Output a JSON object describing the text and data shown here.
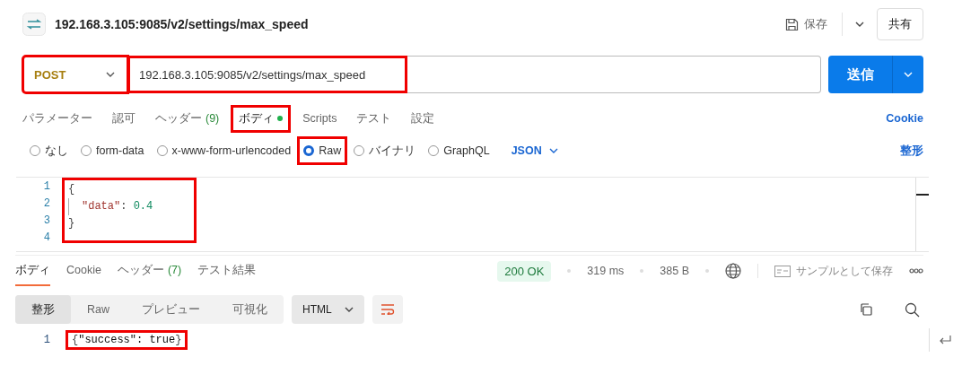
{
  "title": "192.168.3.105:9085/v2/settings/max_speed",
  "save_label": "保存",
  "share_label": "共有",
  "request": {
    "method": {
      "label": "POST",
      "highlighted": true
    },
    "url": {
      "value": "192.168.3.105:9085/v2/settings/max_speed",
      "highlighted": true
    },
    "send_label": "送信"
  },
  "request_tabs": [
    {
      "label": "パラメーター",
      "selected": false,
      "highlighted": false,
      "dot": false
    },
    {
      "label": "認可",
      "selected": false,
      "highlighted": false,
      "dot": false
    },
    {
      "label": "ヘッダー",
      "count": "(9)",
      "selected": false,
      "highlighted": false,
      "dot": false
    },
    {
      "label": "ボディ",
      "selected": true,
      "highlighted": true,
      "dot": true
    },
    {
      "label": "Scripts",
      "selected": false,
      "highlighted": false,
      "dot": false
    },
    {
      "label": "テスト",
      "selected": false,
      "highlighted": false,
      "dot": false
    },
    {
      "label": "設定",
      "selected": false,
      "highlighted": false,
      "dot": false
    }
  ],
  "cookie_link": "Cookie",
  "body_types": [
    {
      "label": "なし",
      "selected": false,
      "highlighted": false
    },
    {
      "label": "form-data",
      "selected": false,
      "highlighted": false
    },
    {
      "label": "x-www-form-urlencoded",
      "selected": false,
      "highlighted": false
    },
    {
      "label": "Raw",
      "selected": true,
      "highlighted": true
    },
    {
      "label": "バイナリ",
      "selected": false,
      "highlighted": false
    },
    {
      "label": "GraphQL",
      "selected": false,
      "highlighted": false
    }
  ],
  "body_format": "JSON",
  "beautify_label": "整形",
  "request_body": {
    "highlighted": true,
    "lines": [
      {
        "number": "1",
        "tokens": [
          {
            "kind": "punct",
            "text": "{"
          }
        ]
      },
      {
        "number": "2",
        "indent": true,
        "tokens": [
          {
            "kind": "key",
            "text": "\"data\""
          },
          {
            "kind": "punct",
            "text": ": "
          },
          {
            "kind": "number",
            "text": "0.4"
          }
        ]
      },
      {
        "number": "3",
        "tokens": [
          {
            "kind": "punct",
            "text": "}"
          }
        ]
      },
      {
        "number": "4"
      }
    ]
  },
  "response_tabs": [
    {
      "label": "ボディ",
      "selected": true
    },
    {
      "label": "Cookie",
      "selected": false
    },
    {
      "label": "ヘッダー",
      "count": "(7)",
      "selected": false
    },
    {
      "label": "テスト結果",
      "selected": false
    }
  ],
  "status": {
    "code": "200 OK",
    "time": "319 ms",
    "size": "385 B",
    "save_example": "サンプルとして保存"
  },
  "view_modes": [
    {
      "label": "整形",
      "selected": true
    },
    {
      "label": "Raw",
      "selected": false
    },
    {
      "label": "プレビュー",
      "selected": false
    },
    {
      "label": "可視化",
      "selected": false
    }
  ],
  "response_language": "HTML",
  "response_body": {
    "highlighted": true,
    "lines": [
      {
        "number": "1",
        "tokens": [
          {
            "kind": "punct",
            "text": "{"
          },
          {
            "kind": "plain",
            "text": "\"success\": true"
          },
          {
            "kind": "punct",
            "text": "}"
          }
        ]
      }
    ]
  }
}
